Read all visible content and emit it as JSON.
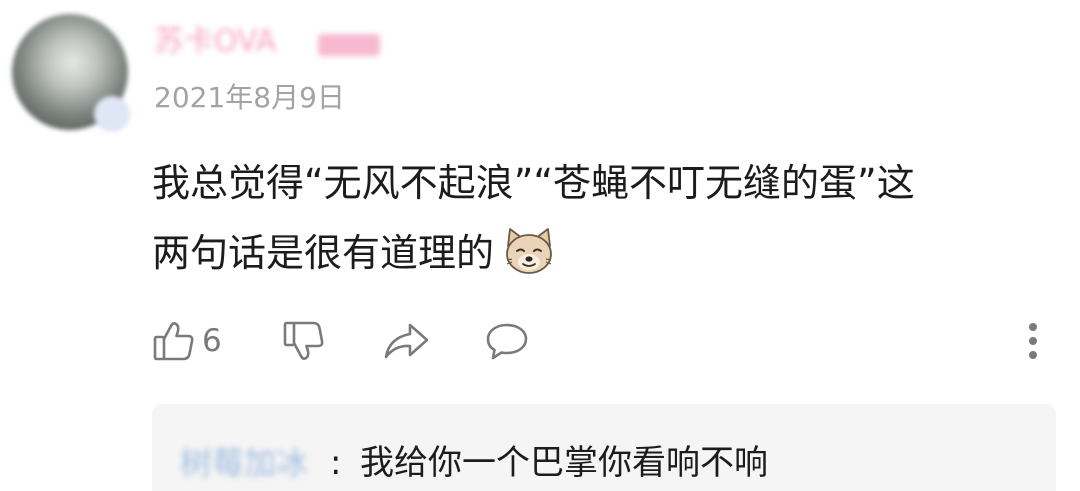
{
  "comment": {
    "username": "苏卡OVA",
    "date": "2021年8月9日",
    "text_line1": "我总觉得“无风不起浪”“苍蝇不叮无缝的蛋”这",
    "text_line2": "两句话是很有道理的",
    "emoji": "dog-face-emoji"
  },
  "actions": {
    "like_count": "6",
    "icons": [
      "thumbs-up-icon",
      "thumbs-down-icon",
      "share-icon",
      "comment-icon",
      "more-vertical-icon"
    ]
  },
  "reply": {
    "username": "树莓加冰",
    "colon": ":",
    "text": "我给你一个巴掌你看响不响"
  },
  "colors": {
    "username": "#f7a4c1",
    "reply_username": "#9fbce0",
    "icon": "#7a7a7a",
    "text": "#1c1c1c",
    "date": "#a3a3a3",
    "reply_bg": "#f5f5f5"
  }
}
